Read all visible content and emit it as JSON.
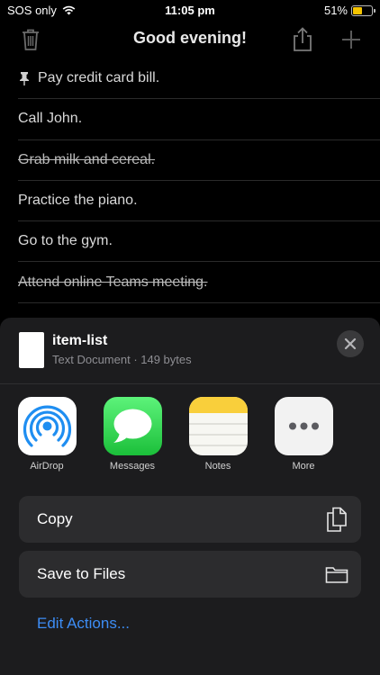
{
  "status_bar": {
    "carrier": "SOS only",
    "time": "11:05 pm",
    "battery_percent": "51%",
    "battery_level": 0.51
  },
  "nav": {
    "title": "Good evening!"
  },
  "list": {
    "items": [
      {
        "text": "Pay credit card bill.",
        "pinned": true,
        "done": false
      },
      {
        "text": "Call John.",
        "pinned": false,
        "done": false
      },
      {
        "text": "Grab milk and cereal.",
        "pinned": false,
        "done": true
      },
      {
        "text": "Practice the piano.",
        "pinned": false,
        "done": false
      },
      {
        "text": "Go to the gym.",
        "pinned": false,
        "done": false
      },
      {
        "text": "Attend online Teams meeting.",
        "pinned": false,
        "done": true
      }
    ]
  },
  "share_sheet": {
    "file_name": "item-list",
    "file_meta": "Text Document · 149 bytes",
    "apps": [
      {
        "label": "AirDrop",
        "icon": "airdrop-icon"
      },
      {
        "label": "Messages",
        "icon": "messages-icon"
      },
      {
        "label": "Notes",
        "icon": "notes-icon"
      },
      {
        "label": "More",
        "icon": "more-icon"
      }
    ],
    "actions": [
      {
        "label": "Copy",
        "icon": "copy-icon"
      },
      {
        "label": "Save to Files",
        "icon": "folder-icon"
      }
    ],
    "edit_actions": "Edit Actions..."
  },
  "colors": {
    "accent": "#3d8df5",
    "battery": "#f5c400",
    "sheet_bg": "#1c1c1e",
    "action_bg": "#2c2c2e"
  }
}
